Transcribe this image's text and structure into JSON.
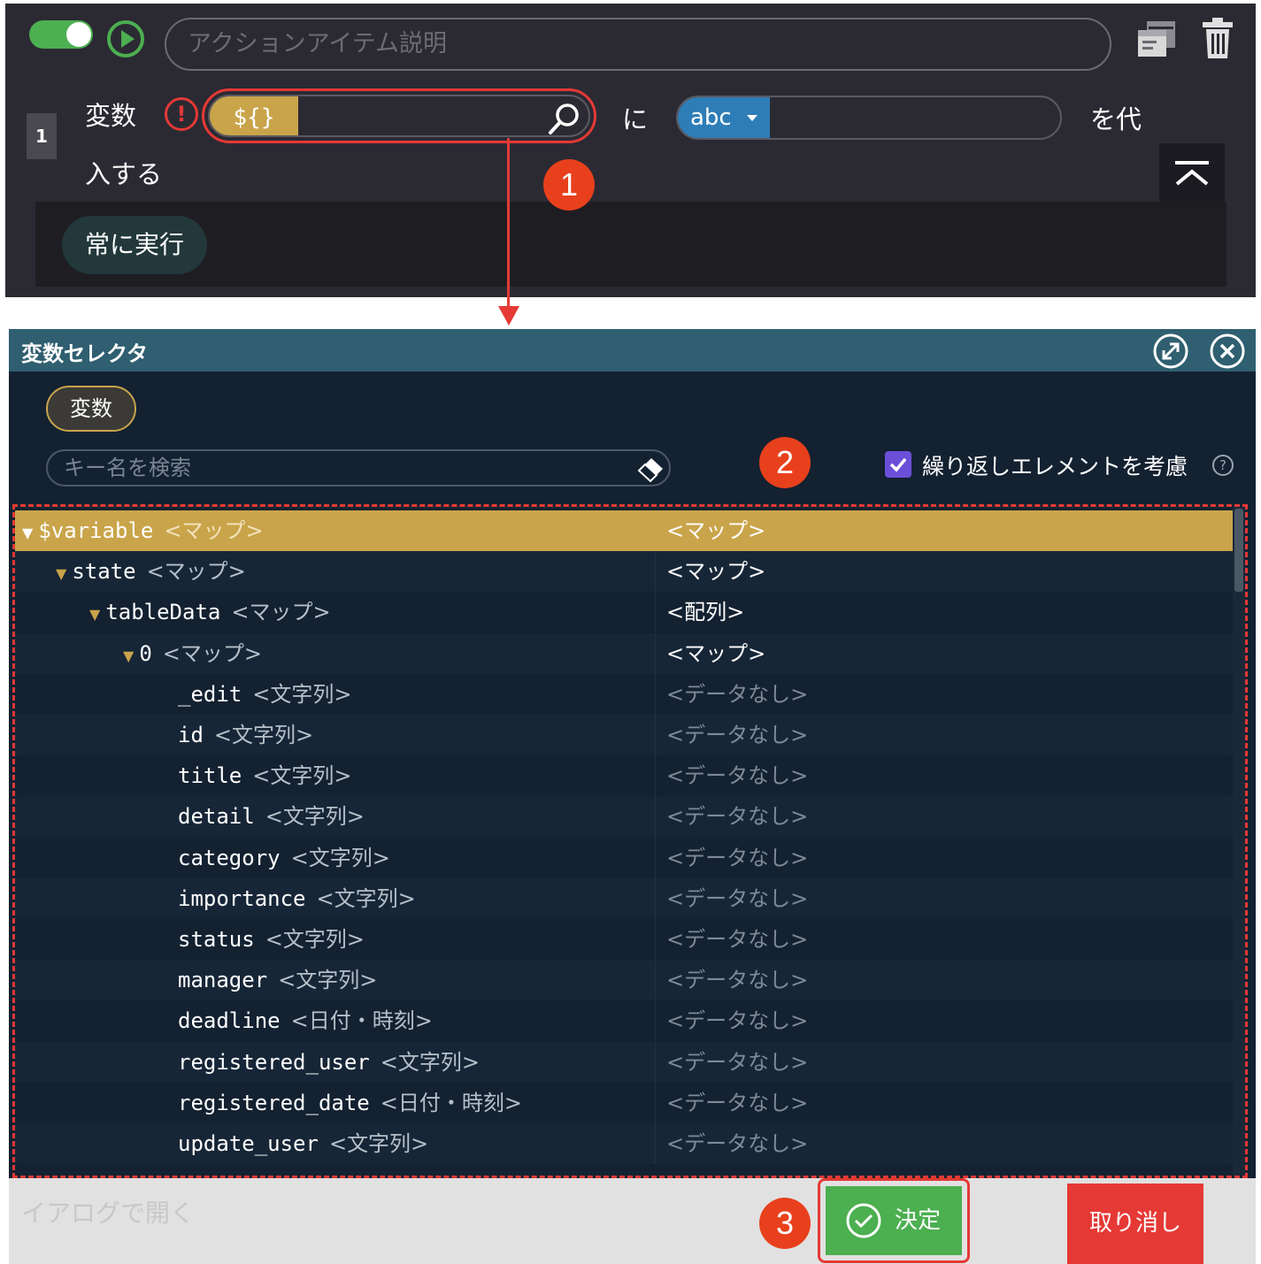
{
  "action_item": {
    "description_placeholder": "アクションアイテム説明",
    "row_number": "1",
    "variable_label": "変数",
    "variable_chip": "${}",
    "particle_ni": "に",
    "value_type": "abc",
    "assign_label_1": "を代",
    "assign_label_2": "入する",
    "always_run": "常に実行",
    "toggle_on": true,
    "colors": {
      "panel_bg": "#2b2a33",
      "toggle": "#4caf50",
      "variable_chip": "#c9a44a",
      "value_chip": "#2e7db6"
    }
  },
  "annotations": {
    "badge_1": "1",
    "badge_2": "2",
    "badge_3": "3"
  },
  "dialog": {
    "title": "変数セレクタ",
    "tab_label": "変数",
    "search_placeholder": "キー名を検索",
    "repeat_checkbox_label": "繰り返しエレメントを考慮",
    "repeat_checked": true,
    "tree": [
      {
        "key": "$variable",
        "type": "<マップ>",
        "value": "<マップ>",
        "depth": 0,
        "expanded": true,
        "selected": true
      },
      {
        "key": "state",
        "type": "<マップ>",
        "value": "<マップ>",
        "depth": 1,
        "expanded": true
      },
      {
        "key": "tableData",
        "type": "<マップ>",
        "value": "<配列>",
        "depth": 2,
        "expanded": true
      },
      {
        "key": "0",
        "type": "<マップ>",
        "value": "<マップ>",
        "depth": 3,
        "expanded": true
      },
      {
        "key": "_edit",
        "type": "<文字列>",
        "value": "<データなし>",
        "depth": 4
      },
      {
        "key": "id",
        "type": "<文字列>",
        "value": "<データなし>",
        "depth": 4
      },
      {
        "key": "title",
        "type": "<文字列>",
        "value": "<データなし>",
        "depth": 4
      },
      {
        "key": "detail",
        "type": "<文字列>",
        "value": "<データなし>",
        "depth": 4
      },
      {
        "key": "category",
        "type": "<文字列>",
        "value": "<データなし>",
        "depth": 4
      },
      {
        "key": "importance",
        "type": "<文字列>",
        "value": "<データなし>",
        "depth": 4
      },
      {
        "key": "status",
        "type": "<文字列>",
        "value": "<データなし>",
        "depth": 4
      },
      {
        "key": "manager",
        "type": "<文字列>",
        "value": "<データなし>",
        "depth": 4
      },
      {
        "key": "deadline",
        "type": "<日付・時刻>",
        "value": "<データなし>",
        "depth": 4
      },
      {
        "key": "registered_user",
        "type": "<文字列>",
        "value": "<データなし>",
        "depth": 4
      },
      {
        "key": "registered_date",
        "type": "<日付・時刻>",
        "value": "<データなし>",
        "depth": 4
      },
      {
        "key": "update_user",
        "type": "<文字列>",
        "value": "<データなし>",
        "depth": 4
      }
    ],
    "footer_link": "イアログで開く",
    "ok_label": "決定",
    "cancel_label": "取り消し",
    "colors": {
      "header": "#2f5f70",
      "body": "#132131",
      "selected_row": "#c9a44a",
      "ok": "#4caf50",
      "cancel": "#e53935",
      "annotation": "#e53935"
    }
  }
}
